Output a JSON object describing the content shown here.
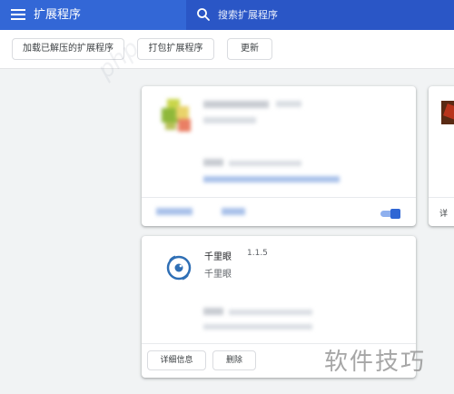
{
  "header": {
    "title": "扩展程序",
    "search_placeholder": "搜索扩展程序"
  },
  "toolbar": {
    "load_unpacked_label": "加载已解压的扩展程序",
    "pack_label": "打包扩展程序",
    "update_label": "更新"
  },
  "extensions": [
    {
      "name": "千里眼",
      "version": "1.1.5",
      "description": "千里眼",
      "details_label": "详细信息",
      "remove_label": "删除"
    }
  ],
  "third_card": {
    "button_label": "详"
  },
  "watermark": {
    "text": "软件技巧",
    "site": "php"
  },
  "colors": {
    "header_bg": "#3367d6",
    "search_bg": "#2a56c6",
    "accent": "#2f66d4",
    "page_bg": "#f1f3f4"
  },
  "icons": {
    "menu": "hamburger-menu-icon",
    "search": "search-icon",
    "extension": "eye-target-icon"
  }
}
